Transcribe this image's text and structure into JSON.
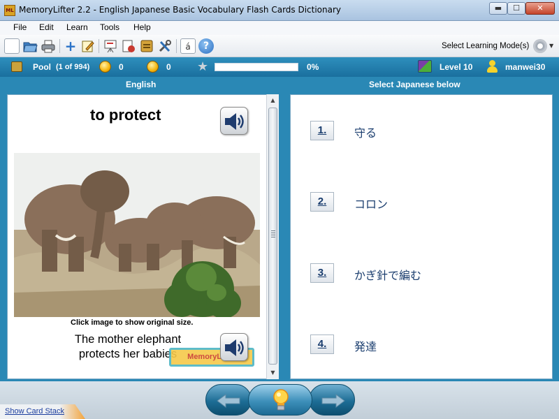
{
  "window": {
    "icon_text": "ML",
    "title": "MemoryLifter 2.2 - English Japanese Basic Vocabulary Flash Cards Dictionary",
    "controls": [
      "minimize",
      "maximize",
      "close"
    ]
  },
  "menu": [
    "File",
    "Edit",
    "Learn",
    "Tools",
    "Help"
  ],
  "toolbar": {
    "icons": [
      "new-icon",
      "open-icon",
      "print-icon",
      "add-card-icon",
      "edit-icon",
      "presentation-icon",
      "print-cards-icon",
      "card-list-icon",
      "settings-tools-icon",
      "character-map-icon",
      "help-icon"
    ],
    "character_map_glyph": "á",
    "help_glyph": "?",
    "mode_label": "Select Learning Mode(s)"
  },
  "status": {
    "pool_label": "Pool",
    "pool_count": "(1 of 994)",
    "correct_count": "0",
    "wrong_count": "0",
    "progress_percent": 0,
    "progress_label": "0%",
    "level_label": "Level 10",
    "username": "manwei30"
  },
  "left": {
    "header": "English",
    "word": "to protect",
    "caption": "Click image to show original size.",
    "example": "The mother elephant protects her babies",
    "stamp": "MemoryLifter"
  },
  "right": {
    "header": "Select Japanese below",
    "choices": [
      {
        "number": "1.",
        "text": "守る"
      },
      {
        "number": "2.",
        "text": "コロン"
      },
      {
        "number": "3.",
        "text": "かぎ針で編む"
      },
      {
        "number": "4.",
        "text": "発達"
      }
    ]
  },
  "footer": {
    "show_stack": "Show Card Stack"
  },
  "colors": {
    "status_bar": "#2280b0",
    "content_bg": "#2a88b5",
    "link": "#1a3d6e"
  }
}
